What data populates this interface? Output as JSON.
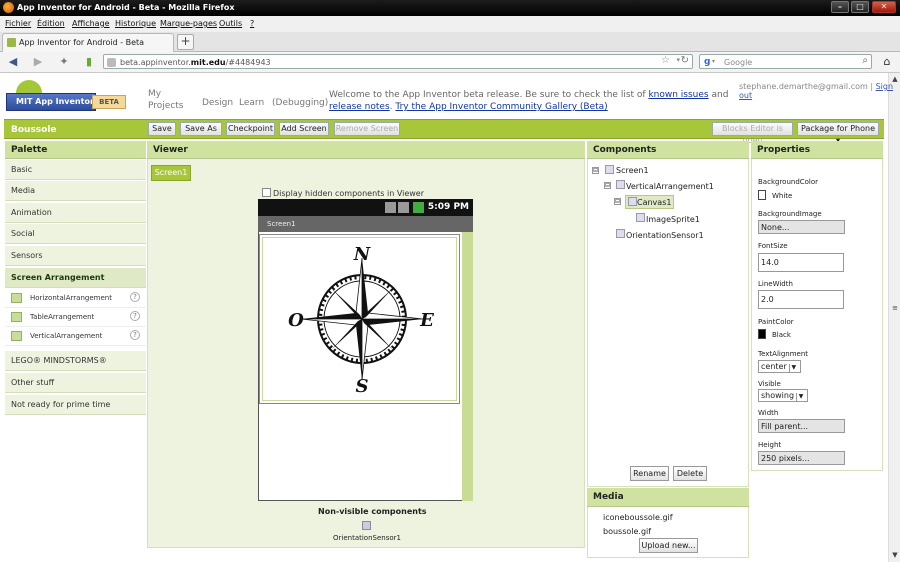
{
  "window": {
    "title": "App Inventor for Android - Beta - Mozilla Firefox"
  },
  "menu": [
    "Fichier",
    "Édition",
    "Affichage",
    "Historique",
    "Marque-pages",
    "Outils",
    "?"
  ],
  "tab": {
    "label": "App Inventor for Android - Beta",
    "new_tab": "+"
  },
  "nav": {
    "url_host": "beta.appinventor.",
    "url_domain": "mit.edu",
    "url_path": "/#4484943",
    "search_placeholder": "Google",
    "search_engine": "g"
  },
  "header": {
    "logo_text": "MIT App Inventor",
    "beta_badge": "BETA",
    "nav_links": [
      "My Projects",
      "Design",
      "Learn",
      "(Debugging)"
    ],
    "welcome_text": "Welcome to the App Inventor beta release. Be sure to check the list of",
    "known_issues": "known issues",
    "and": "and",
    "release_notes": "release notes",
    "gallery_link": "Try the App Inventor Community Gallery (Beta)",
    "account_email": "stephane.demarthe@gmail.com",
    "sep": "|",
    "sign_out": "Sign out"
  },
  "project": {
    "name": "Boussole",
    "buttons": {
      "save": "Save",
      "save_as": "Save As",
      "checkpoint": "Checkpoint",
      "add_screen": "Add Screen",
      "remove_screen": "Remove Screen"
    },
    "blocks_editor": "Blocks Editor is open",
    "package": "Package for Phone"
  },
  "palette": {
    "title": "Palette",
    "categories": [
      "Basic",
      "Media",
      "Animation",
      "Social",
      "Sensors"
    ],
    "open_category": "Screen Arrangement",
    "items": [
      "HorizontalArrangement",
      "TableArrangement",
      "VerticalArrangement"
    ],
    "help": "?",
    "more_categories": [
      "LEGO® MINDSTORMS®",
      "Other stuff",
      "Not ready for prime time"
    ]
  },
  "viewer": {
    "title": "Viewer",
    "screen_tab": "Screen1",
    "hidden_label": "Display hidden components in Viewer",
    "phone_time": "5:09 PM",
    "app_title": "Screen1",
    "compass": {
      "n": "N",
      "e": "E",
      "s": "S",
      "o": "O"
    },
    "nonvisible_title": "Non-visible components",
    "nonvisible_item": "OrientationSensor1"
  },
  "components": {
    "title": "Components",
    "tree": [
      "Screen1",
      "VerticalArrangement1",
      "Canvas1",
      "ImageSprite1",
      "OrientationSensor1"
    ],
    "toggle": "⊟",
    "rename": "Rename",
    "delete": "Delete"
  },
  "media": {
    "title": "Media",
    "files": [
      "iconeboussole.gif",
      "boussole.gif"
    ],
    "upload": "Upload new..."
  },
  "properties": {
    "title": "Properties",
    "background_color_label": "BackgroundColor",
    "background_color_value": "White",
    "background_image_label": "BackgroundImage",
    "background_image_value": "None...",
    "font_size_label": "FontSize",
    "font_size_value": "14.0",
    "line_width_label": "LineWidth",
    "line_width_value": "2.0",
    "paint_color_label": "PaintColor",
    "paint_color_value": "Black",
    "text_alignment_label": "TextAlignment",
    "text_alignment_value": "center",
    "visible_label": "Visible",
    "visible_value": "showing",
    "width_label": "Width",
    "width_value": "Fill parent...",
    "height_label": "Height",
    "height_value": "250 pixels..."
  },
  "colors": {
    "accent_green": "#a8c63a",
    "panel_header": "#d0e2a0",
    "link_blue": "#1034a6"
  }
}
